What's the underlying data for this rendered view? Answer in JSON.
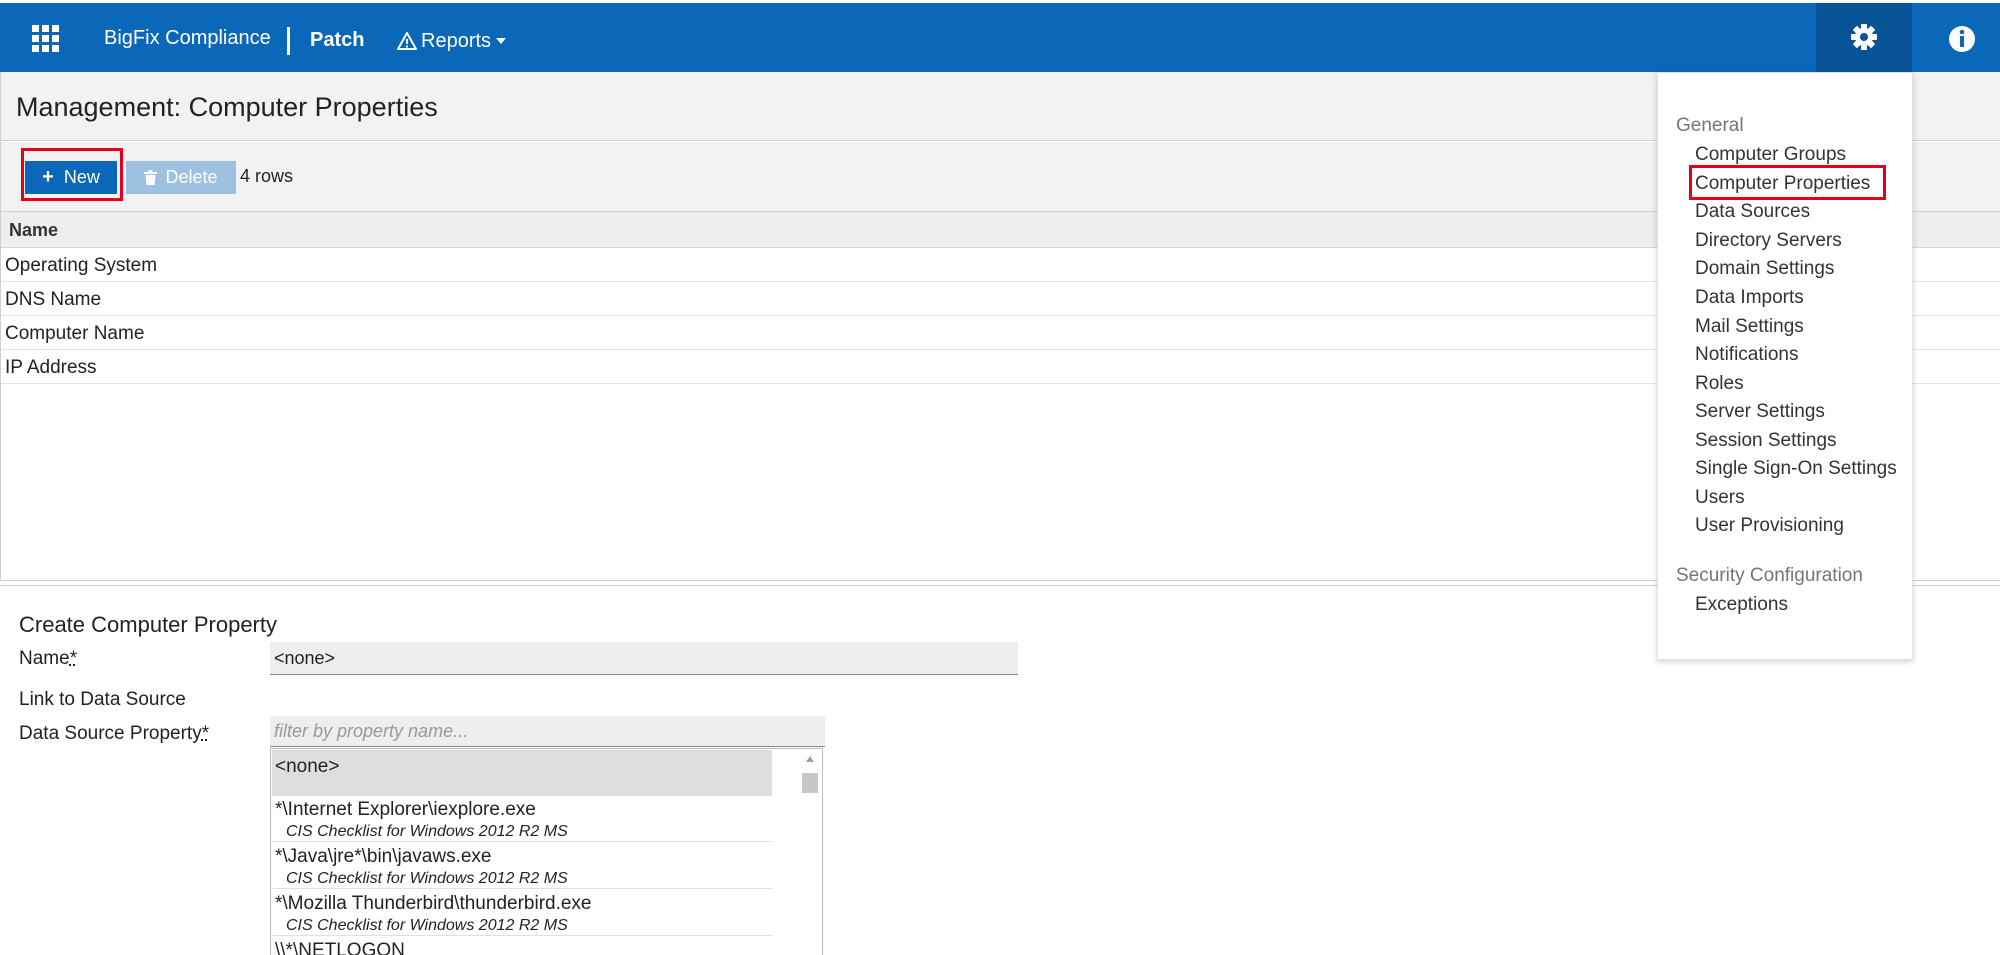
{
  "header": {
    "brand": "BigFix Compliance",
    "app": "Patch",
    "reports_label": "Reports",
    "accent": "#0b68b9"
  },
  "icons": [
    "apps-grid-icon",
    "warning-triangle-icon",
    "chevron-down-icon",
    "gear-icon",
    "info-icon",
    "plus-icon",
    "trash-icon"
  ],
  "page": {
    "title": "Management: Computer Properties"
  },
  "toolbar": {
    "new_label": "New",
    "delete_label": "Delete",
    "row_count": "4 rows"
  },
  "table": {
    "column": "Name",
    "rows": [
      "Operating System",
      "DNS Name",
      "Computer Name",
      "IP Address"
    ]
  },
  "form": {
    "title": "Create Computer Property",
    "name_label": "Name",
    "name_required": "*",
    "name_value": "<none>",
    "link_label": "Link to Data Source",
    "dsp_label": "Data Source Property",
    "dsp_required": "*",
    "filter_placeholder": "filter by property name...",
    "options": [
      {
        "main": "<none>"
      },
      {
        "main": "*\\Internet Explorer\\iexplore.exe",
        "sub": "CIS Checklist for Windows 2012 R2 MS"
      },
      {
        "main": "*\\Java\\jre*\\bin\\javaws.exe",
        "sub": "CIS Checklist for Windows 2012 R2 MS"
      },
      {
        "main": "*\\Mozilla Thunderbird\\thunderbird.exe",
        "sub": "CIS Checklist for Windows 2012 R2 MS"
      },
      {
        "main": "\\\\*\\NETLOGON"
      }
    ]
  },
  "settings_menu": {
    "general_header": "General",
    "general_items": [
      "Computer Groups",
      "Computer Properties",
      "Data Sources",
      "Directory Servers",
      "Domain Settings",
      "Data Imports",
      "Mail Settings",
      "Notifications",
      "Roles",
      "Server Settings",
      "Session Settings",
      "Single Sign-On Settings",
      "Users",
      "User Provisioning"
    ],
    "security_header": "Security Configuration",
    "security_items": [
      "Exceptions"
    ],
    "highlighted_item": "Computer Properties"
  }
}
